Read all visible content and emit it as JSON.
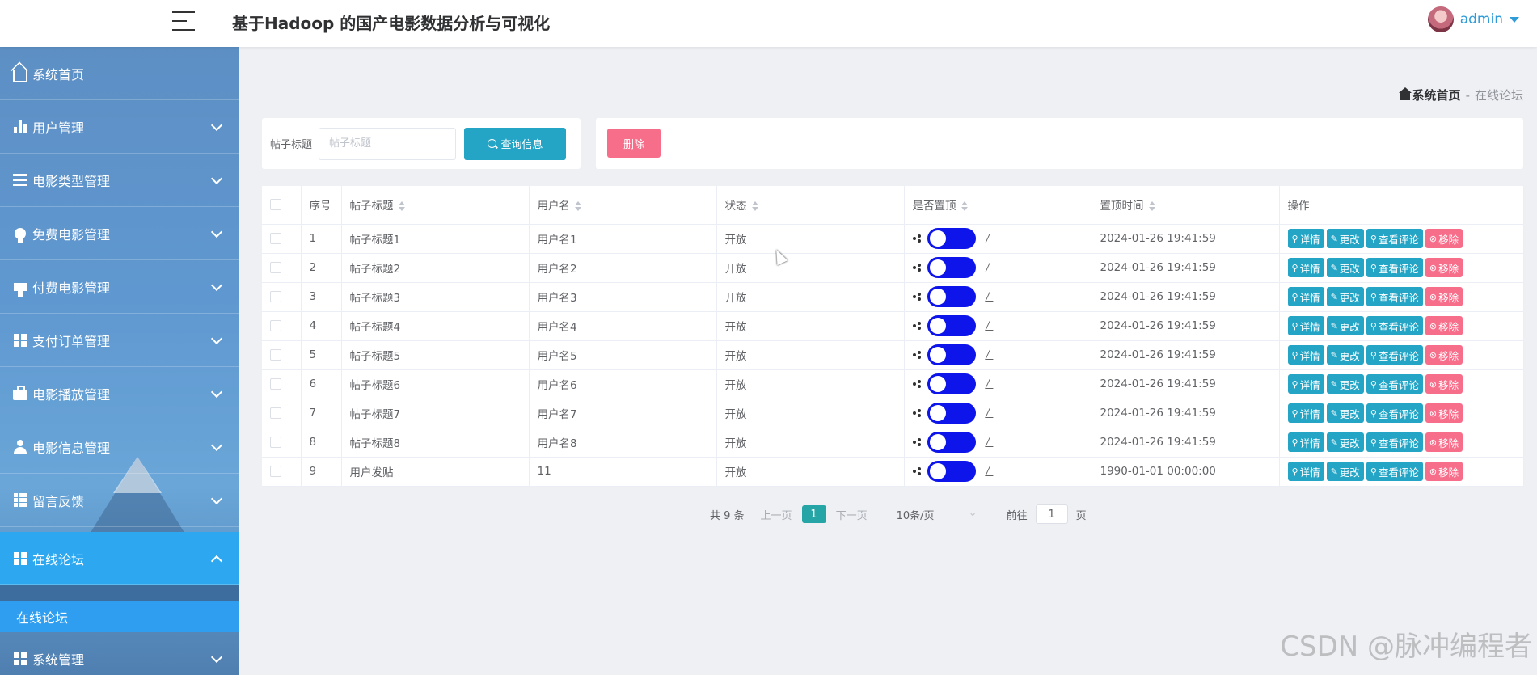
{
  "header": {
    "title": "基于Hadoop 的国产电影数据分析与可视化",
    "user": "admin"
  },
  "sidebar": {
    "items": [
      {
        "label": "系统首页",
        "icon": "home-icon"
      },
      {
        "label": "用户管理",
        "icon": "bar-chart-icon"
      },
      {
        "label": "电影类型管理",
        "icon": "list-icon"
      },
      {
        "label": "免费电影管理",
        "icon": "bulb-icon"
      },
      {
        "label": "付费电影管理",
        "icon": "pay-icon"
      },
      {
        "label": "支付订单管理",
        "icon": "grid-icon"
      },
      {
        "label": "电影播放管理",
        "icon": "briefcase-icon"
      },
      {
        "label": "电影信息管理",
        "icon": "user-icon"
      },
      {
        "label": "留言反馈",
        "icon": "grid-nine-icon"
      },
      {
        "label": "在线论坛",
        "icon": "grid-icon"
      },
      {
        "label": "系统管理",
        "icon": "grid-icon"
      }
    ],
    "sub_item": "在线论坛"
  },
  "breadcrumb": {
    "home": "系统首页",
    "sep": "-",
    "current": "在线论坛"
  },
  "search": {
    "label": "帖子标题",
    "placeholder": "帖子标题",
    "button": "查询信息"
  },
  "actions": {
    "delete": "删除"
  },
  "table": {
    "headers": [
      "序号",
      "帖子标题",
      "用户名",
      "状态",
      "是否置顶",
      "置顶时间",
      "操作"
    ],
    "rows": [
      {
        "no": "1",
        "title": "帖子标题1",
        "user": "用户名1",
        "status": "开放",
        "time": "2024-01-26 19:41:59"
      },
      {
        "no": "2",
        "title": "帖子标题2",
        "user": "用户名2",
        "status": "开放",
        "time": "2024-01-26 19:41:59"
      },
      {
        "no": "3",
        "title": "帖子标题3",
        "user": "用户名3",
        "status": "开放",
        "time": "2024-01-26 19:41:59"
      },
      {
        "no": "4",
        "title": "帖子标题4",
        "user": "用户名4",
        "status": "开放",
        "time": "2024-01-26 19:41:59"
      },
      {
        "no": "5",
        "title": "帖子标题5",
        "user": "用户名5",
        "status": "开放",
        "time": "2024-01-26 19:41:59"
      },
      {
        "no": "6",
        "title": "帖子标题6",
        "user": "用户名6",
        "status": "开放",
        "time": "2024-01-26 19:41:59"
      },
      {
        "no": "7",
        "title": "帖子标题7",
        "user": "用户名7",
        "status": "开放",
        "time": "2024-01-26 19:41:59"
      },
      {
        "no": "8",
        "title": "帖子标题8",
        "user": "用户名8",
        "status": "开放",
        "time": "2024-01-26 19:41:59"
      },
      {
        "no": "9",
        "title": "用户发贴",
        "user": "11",
        "status": "开放",
        "time": "1990-01-01 00:00:00"
      }
    ],
    "ops": {
      "detail": "详情",
      "edit": "更改",
      "comments": "查看评论",
      "remove": "移除"
    }
  },
  "pagination": {
    "total": "共 9 条",
    "prev": "上一页",
    "page": "1",
    "next": "下一页",
    "size": "10条/页",
    "goto": "前往",
    "goto_value": "1",
    "page_unit": "页"
  },
  "watermark": "CSDN @脉冲编程者",
  "colors": {
    "primary": "#25a5c6",
    "danger": "#f76e8b",
    "switch_on": "#0d15ea",
    "sidebar_active": "#2da8f0"
  }
}
